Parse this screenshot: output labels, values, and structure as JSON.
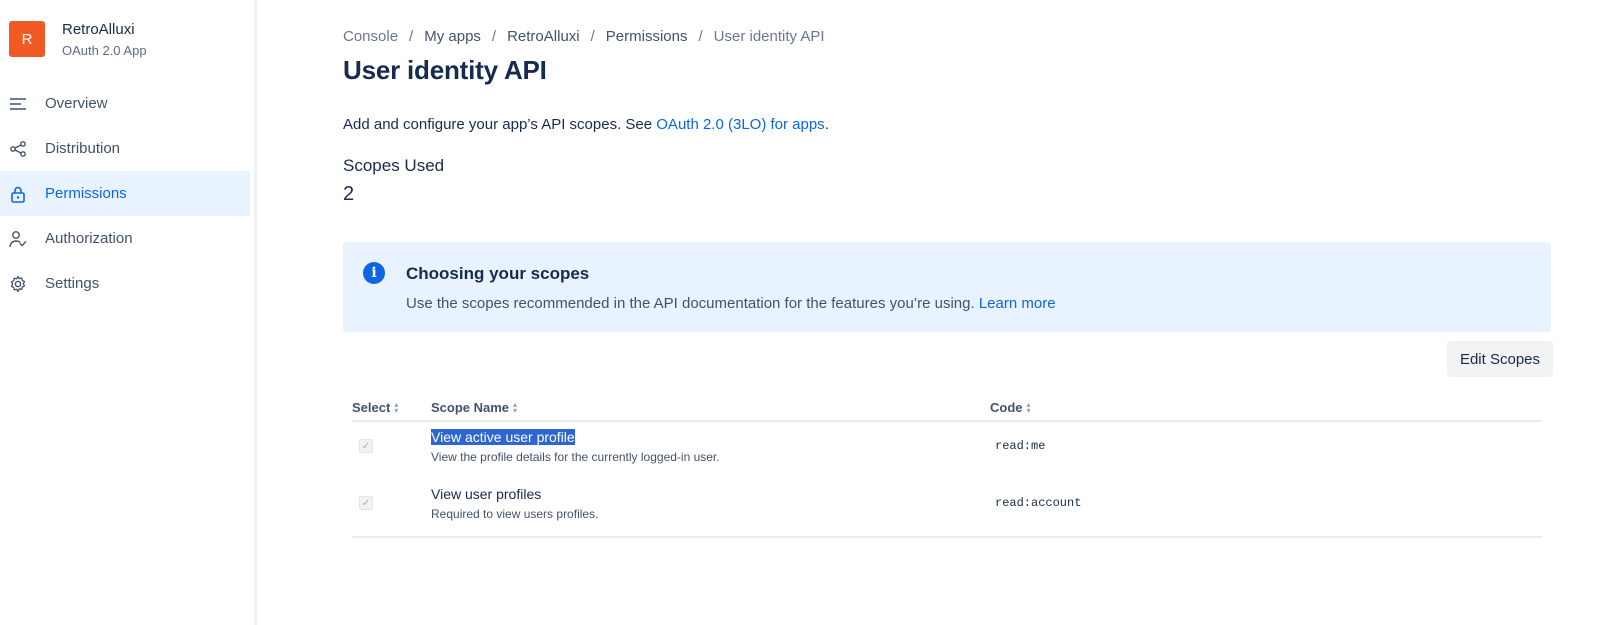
{
  "app": {
    "avatar_letter": "R",
    "name": "RetroAlluxi",
    "type": "OAuth 2.0 App",
    "avatar_color": "#f15a24"
  },
  "sidebar": {
    "items": [
      {
        "label": "Overview",
        "icon": "menu-lines-icon"
      },
      {
        "label": "Distribution",
        "icon": "share-icon"
      },
      {
        "label": "Permissions",
        "icon": "lock-icon",
        "active": true
      },
      {
        "label": "Authorization",
        "icon": "user-check-icon"
      },
      {
        "label": "Settings",
        "icon": "gear-icon"
      }
    ]
  },
  "breadcrumb": [
    "Console",
    "My apps",
    "RetroAlluxi",
    "Permissions",
    "User identity API"
  ],
  "breadcrumb_sep": "/",
  "page_title": "User identity API",
  "description": {
    "text": "Add and configure your app’s API scopes. See ",
    "link": "OAuth 2.0 (3LO) for apps",
    "suffix": "."
  },
  "scopes_used": {
    "label": "Scopes Used",
    "count": "2"
  },
  "info_panel": {
    "icon": "i",
    "title": "Choosing your scopes",
    "text": "Use the scopes recommended in the API documentation for the features you’re using. ",
    "link": "Learn more"
  },
  "edit_scopes_label": "Edit Scopes",
  "table": {
    "columns": [
      "Select",
      "Scope Name",
      "Code"
    ],
    "rows": [
      {
        "name": "View active user profile",
        "desc": "View the profile details for the currently logged-in user.",
        "code": "read:me",
        "checked": true,
        "name_selected": true
      },
      {
        "name": "View user profiles",
        "desc": "Required to view users profiles.",
        "code": "read:account",
        "checked": true
      }
    ]
  },
  "colors": {
    "accent": "#0c66e4",
    "active_bg": "#e9f2ff",
    "info_bg": "#e9f2ff"
  }
}
